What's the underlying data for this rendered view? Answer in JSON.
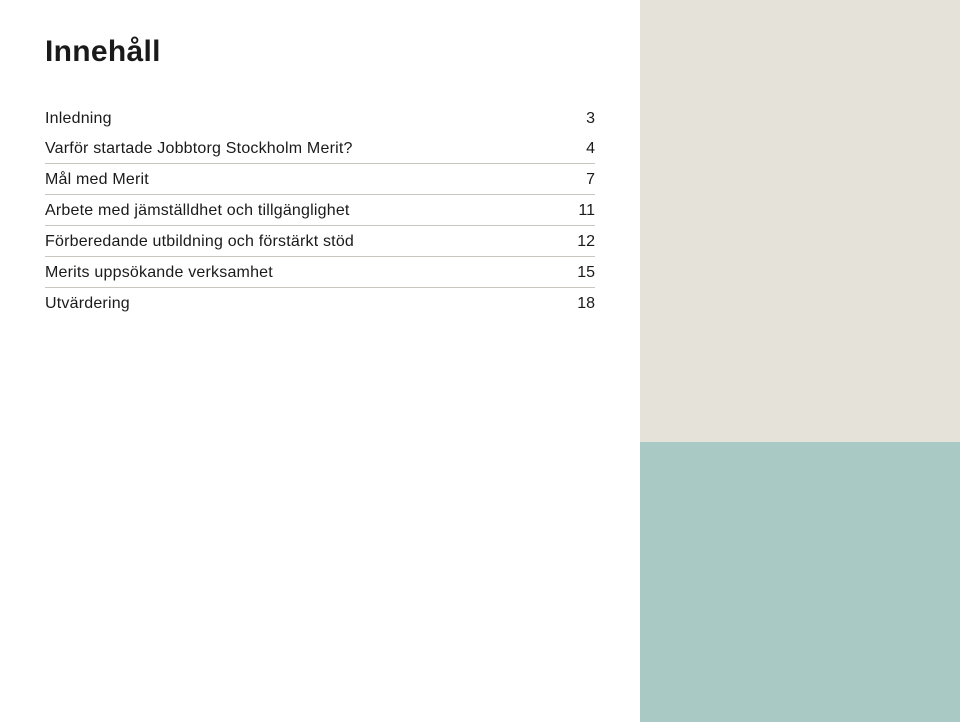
{
  "title": "Innehåll",
  "toc": [
    {
      "label": "Inledning",
      "page": "3"
    },
    {
      "label": "Varför startade Jobbtorg Stockholm Merit?",
      "page": "4"
    },
    {
      "label": "Mål med Merit",
      "page": "7"
    },
    {
      "label": "Arbete med jämställdhet och tillgänglighet",
      "page": "11"
    },
    {
      "label": "Förberedande utbildning och förstärkt stöd",
      "page": "12"
    },
    {
      "label": "Merits uppsökande verksamhet",
      "page": "15"
    },
    {
      "label": "Utvärdering",
      "page": "18"
    }
  ]
}
